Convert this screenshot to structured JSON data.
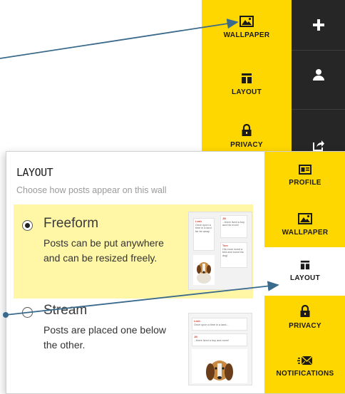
{
  "top_sidebar": {
    "items": [
      {
        "label": "WALLPAPER",
        "icon": "image-icon"
      },
      {
        "label": "LAYOUT",
        "icon": "layout-icon"
      },
      {
        "label": "PRIVACY",
        "icon": "lock-icon"
      }
    ],
    "dark_items": [
      {
        "icon": "plus-icon"
      },
      {
        "icon": "user-icon"
      },
      {
        "icon": "share-icon"
      }
    ]
  },
  "layout_panel": {
    "title": "LAYOUT",
    "subtitle": "Choose how posts appear on this wall",
    "options": [
      {
        "name": "Freeform",
        "description": "Posts can be put anywhere and can be resized freely.",
        "selected": true,
        "thumbnail_notes": [
          {
            "author": "Leah",
            "text": "Once upon a time in a land far far away"
          },
          {
            "author": "Jill",
            "text": "...there lived a boy and his mom!"
          },
          {
            "author": "Tom",
            "text": "His mom loved a bird and loved his dog!"
          }
        ]
      },
      {
        "name": "Stream",
        "description": "Posts are placed one below the other.",
        "selected": false,
        "thumbnail_notes": [
          {
            "author": "Leah",
            "text": "Once upon a time in a land..."
          },
          {
            "author": "Jill",
            "text": "...there lived a boy and mom!"
          }
        ]
      }
    ]
  },
  "panel_sidebar": {
    "items": [
      {
        "label": "PROFILE",
        "icon": "profile-card-icon",
        "active": false
      },
      {
        "label": "WALLPAPER",
        "icon": "image-icon",
        "active": false
      },
      {
        "label": "LAYOUT",
        "icon": "layout-icon",
        "active": true
      },
      {
        "label": "PRIVACY",
        "icon": "lock-icon",
        "active": false
      },
      {
        "label": "NOTIFICATIONS",
        "icon": "notifications-icon",
        "active": false
      }
    ]
  },
  "colors": {
    "accent": "#ffd700",
    "dark": "#262626",
    "highlight": "#fff7a6",
    "arrow": "#3a6a8c"
  }
}
